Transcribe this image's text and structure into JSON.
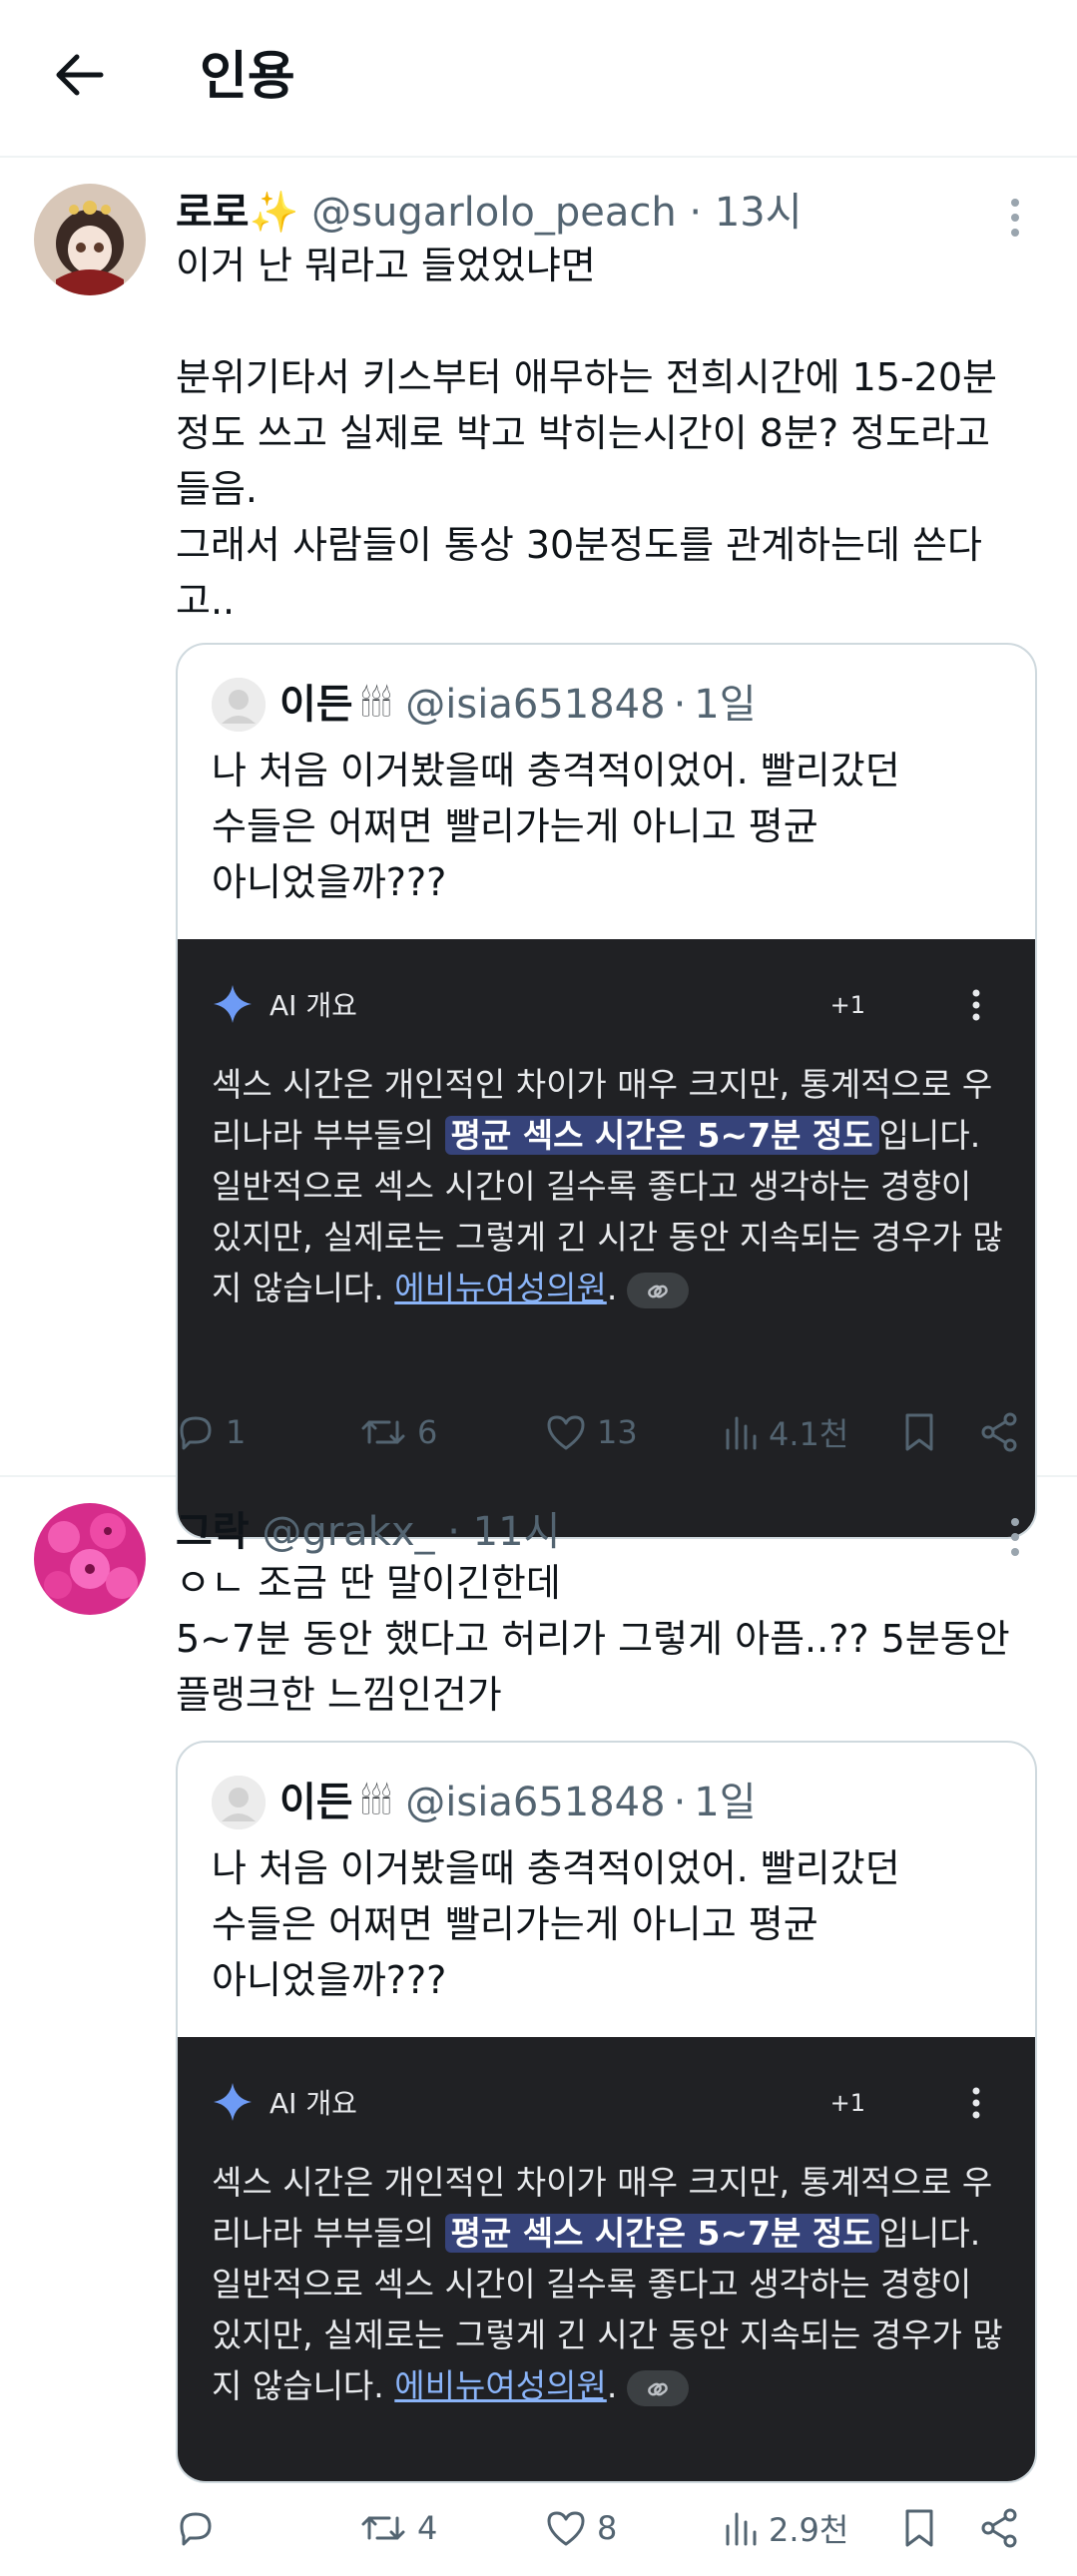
{
  "header": {
    "title": "인용"
  },
  "tweets": [
    {
      "name": "로로✨",
      "handle": "@sugarlolo_peach",
      "dot": "·",
      "time": "13시",
      "text": "이거 난 뭐라고 들었었냐면\n\n분위기타서 키스부터 애무하는 전희시간에 15-20분 정도 쓰고 실제로 박고 박히는시간이 8분? 정도라고 들음.\n그래서 사람들이 통상 30분정도를 관계하는데 쓴다고..",
      "avatar_color": "#5a3b2e",
      "quote": {
        "name": "이든",
        "candles": "🕯🕯🕯",
        "handle": "@isia651848",
        "dot": "·",
        "time": "1일",
        "text": "나 처음 이거봤을때 충격적이었어. 빨리갔던\n수들은 어쩌면 빨리가는게 아니고 평균\n아니었을까???",
        "ai": {
          "title": "AI 개요",
          "plus": "+1",
          "pre": "섹스 시간은 개인적인 차이가 매우 크지만, 통계적으로 우리나라 부부들의 ",
          "highlight": "평균 섹스 시간은 5~7분 정도",
          "post": "입니다. 일반적으로 섹스 시간이 길수록 좋다고 생각하는 경향이 있지만, 실제로는 그렇게 긴 시간 동안 지속되는 경우가 많지 않습니다. ",
          "link": "에비뉴여성의원",
          "end": "."
        }
      },
      "actions": {
        "reply": "1",
        "retweet": "6",
        "like": "13",
        "views": "4.1천"
      }
    },
    {
      "name": "그락",
      "handle": "@grakx_",
      "dot": "·",
      "time": "11시",
      "text": "ㅇㄴ 조금 딴 말이긴한데\n5~7분 동안 했다고 허리가 그렇게 아픔..?? 5분동안 플랭크한 느낌인건가",
      "avatar_color": "#e0308e",
      "quote": {
        "name": "이든",
        "candles": "🕯🕯🕯",
        "handle": "@isia651848",
        "dot": "·",
        "time": "1일",
        "text": "나 처음 이거봤을때 충격적이었어. 빨리갔던\n수들은 어쩌면 빨리가는게 아니고 평균\n아니었을까???",
        "ai": {
          "title": "AI 개요",
          "plus": "+1",
          "pre": "섹스 시간은 개인적인 차이가 매우 크지만, 통계적으로 우리나라 부부들의 ",
          "highlight": "평균 섹스 시간은 5~7분 정도",
          "post": "입니다. 일반적으로 섹스 시간이 길수록 좋다고 생각하는 경향이 있지만, 실제로는 그렇게 긴 시간 동안 지속되는 경우가 많지 않습니다. ",
          "link": "에비뉴여성의원",
          "end": "."
        }
      },
      "actions": {
        "reply": "",
        "retweet": "4",
        "like": "8",
        "views": "2.9천"
      }
    }
  ]
}
